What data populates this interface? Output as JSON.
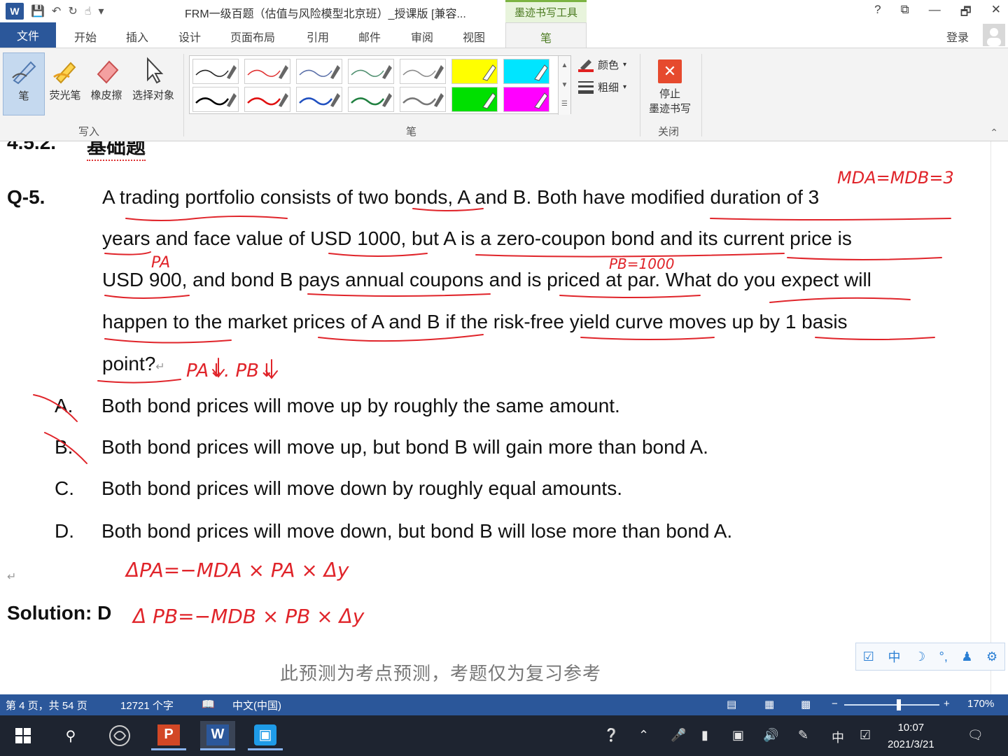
{
  "titlebar": {
    "app_icon": "W",
    "title": "FRM一级百题（估值与风险模型北京班）_授课版 [兼容...",
    "context_group": "墨迹书写工具",
    "controls": [
      "?",
      "⧉",
      "—",
      "🗗",
      "✕"
    ]
  },
  "tabs": {
    "file": "文件",
    "items": [
      "开始",
      "插入",
      "设计",
      "页面布局",
      "引用",
      "邮件",
      "审阅",
      "视图"
    ],
    "pen": "笔",
    "login": "登录"
  },
  "ribbon": {
    "write_group": {
      "label": "写入",
      "buttons": [
        "笔",
        "荧光笔",
        "橡皮擦",
        "选择对象"
      ]
    },
    "pens_group": {
      "label": "笔",
      "pen_colors_top": [
        "#222222",
        "#e03030",
        "#5a6fa8",
        "#4f8f6f",
        "#8a8a8a",
        "#ffff00",
        "#00e5ff"
      ],
      "pen_colors_bottom": [
        "#000000",
        "#e01010",
        "#2050c0",
        "#208040",
        "#777777",
        "#00e000",
        "#ff00ff"
      ],
      "color_label": "颜色",
      "weight_label": "粗细"
    },
    "close_group": {
      "label": "关闭",
      "stop_line1": "停止",
      "stop_line2": "墨迹书写"
    }
  },
  "document": {
    "section_num": "4.5.2.",
    "section_title": "基础题",
    "question_num": "Q-5.",
    "question_lines": [
      "A trading portfolio consists of two bonds, A and B. Both have modified duration of 3",
      "years and face value of USD 1000, but A is a zero-coupon bond and its current price is",
      "USD 900, and bond B pays annual coupons and is priced at par. What do you expect will",
      "happen to the market prices of A and B if the risk-free yield curve moves up by 1 basis",
      "point?"
    ],
    "options": [
      {
        "letter": "A.",
        "text": "Both bond prices will move up by roughly the same amount."
      },
      {
        "letter": "B.",
        "text": "Both bond prices will move up, but bond B will gain more than bond A."
      },
      {
        "letter": "C.",
        "text": "Both bond prices will move down by roughly equal amounts."
      },
      {
        "letter": "D.",
        "text": "Both bond prices will move down, but bond B will lose more than bond A."
      }
    ],
    "solution": "Solution: D",
    "footer_note": "此预测为考点预测，考题仅为复习参考",
    "ink_notes": {
      "md": "MDA=MDB=3",
      "pa": "PA",
      "pb": "PB=1000",
      "down": "PA↓. PB↓",
      "eq1": "ΔPA=−MDA × PA × Δy",
      "eq2": "Δ PB=−MDB × PB × Δy"
    }
  },
  "ime": [
    "中",
    "☽",
    "°,",
    "⚙"
  ],
  "statusbar": {
    "page": "第 4 页，共 54 页",
    "words": "12721 个字",
    "language": "中文(中国)",
    "zoom_minus": "−",
    "zoom_plus": "+",
    "zoom": "170%",
    "zoom_level": 0.57
  },
  "taskbar": {
    "tray_ime": "中",
    "time": "10:07",
    "date": "2021/3/21"
  },
  "colors": {
    "word_blue": "#2b579a",
    "ink_red": "#e0242a",
    "ink_context_green": "#7cb342"
  }
}
